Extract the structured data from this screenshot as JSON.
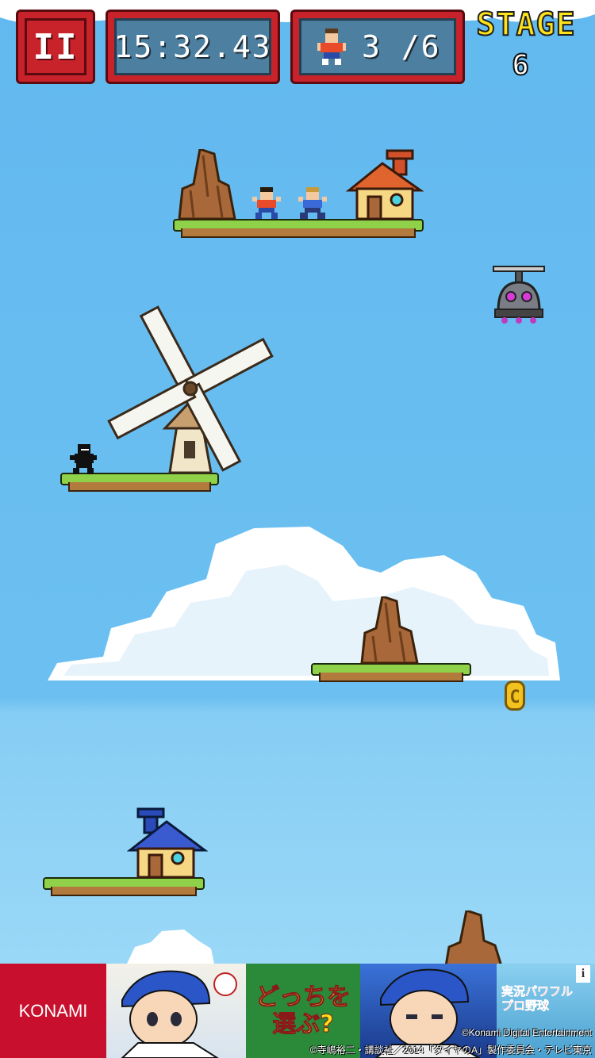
{
  "hud": {
    "pause_label": "II",
    "timer": "15:32.43",
    "rescued": "3 /6",
    "stage_label": "STAGE",
    "stage_number": "6"
  },
  "coin": {
    "label": "C"
  },
  "ad": {
    "brand": "KONAMI",
    "headline": "どっちを選ぶ?",
    "game_title": "実況パワフルプロ野球",
    "info_label": "i",
    "copyright_1": "©Konami Digital Entertainment",
    "copyright_2": "©寺嶋裕二・講談社／2014「ダイヤのA」製作委員会・テレビ東京"
  },
  "colors": {
    "hud_frame": "#c8222b",
    "hud_panel": "#4d7fa0",
    "stage_text": "#ffe31a",
    "sky": "#6fc3f2",
    "grass": "#8fd24a",
    "dirt": "#b27a3c",
    "coin": "#f4c21c"
  }
}
